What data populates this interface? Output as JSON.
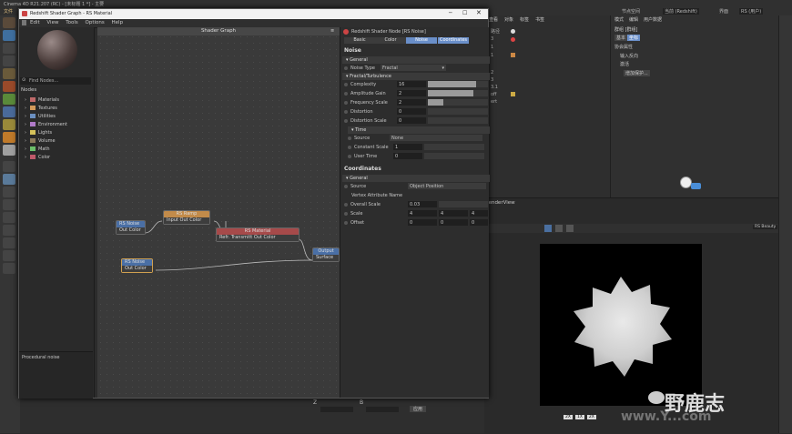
{
  "c4d": {
    "top_title": "Cinema 4D R21.207 (RC) - [未标题 1 *] - 主要",
    "top_menu_first": "文件",
    "top_right_label1": "节点空间",
    "top_right_label2": "当前 (Redshift)",
    "top_right_label3": "界面",
    "top_right_label4": "RS (用户)",
    "obj_menu": [
      "查看",
      "对象",
      "标签",
      "书签"
    ],
    "obj_rows": [
      "路径",
      "3",
      "1",
      "1",
      "2",
      "3",
      "3.1",
      "off",
      "ert"
    ],
    "attr_menu": [
      "模式",
      "编辑",
      "用户数据"
    ],
    "attr_obj_label": "群组 [群组]",
    "attr_tabs": [
      "基本",
      "坐标"
    ],
    "attr_section": "协会属性",
    "attr_row1": "输入反向",
    "attr_row2": "激活",
    "attr_button": "增加保护...",
    "rv_title": "RenderView",
    "rv_toolbar_label": "RS Beauty",
    "rv_bottom_labels": [
      "2X",
      "1X",
      "2X"
    ],
    "watermark_domain": "www.Y...com",
    "watermark_name": "野鹿志",
    "bottom_labels": [
      "Z",
      "B"
    ],
    "bottom_btn": "应用"
  },
  "window": {
    "title": "Redshift Shader Graph - RS Material",
    "menu": [
      "Edit",
      "View",
      "Tools",
      "Options",
      "Help"
    ],
    "controls": [
      "minimize",
      "maximize",
      "close"
    ]
  },
  "sidebar": {
    "search": "Find Nodes...",
    "nodes_label": "Nodes",
    "categories": [
      {
        "label": "Materials",
        "color": "#c06a6a"
      },
      {
        "label": "Textures",
        "color": "#d49a5a"
      },
      {
        "label": "Utilities",
        "color": "#6a8fc0"
      },
      {
        "label": "Environment",
        "color": "#b07ac9"
      },
      {
        "label": "Lights",
        "color": "#d6c25a"
      },
      {
        "label": "Volume",
        "color": "#8a7a5a"
      },
      {
        "label": "Math",
        "color": "#6cc06a"
      },
      {
        "label": "Color",
        "color": "#c05a6a"
      }
    ],
    "description": "Procedural noise"
  },
  "canvas": {
    "title": "Shader Graph",
    "nodes": {
      "noise1": {
        "title": "RS Noise",
        "port": "Out Color"
      },
      "ramp": {
        "title": "RS Ramp",
        "port": "Input  Out Color"
      },
      "material": {
        "title": "RS Material",
        "port": "Refr. Transmitt  Out Color"
      },
      "output": {
        "title": "Output",
        "port": "Surface"
      },
      "noise2": {
        "title": "RS Noise",
        "port": "Out Color"
      }
    }
  },
  "props": {
    "header": "Redshift Shader Node [RS Noise]",
    "tabs": [
      "Basic",
      "Color",
      "Noise",
      "Coordinates"
    ],
    "active_tab": "Noise",
    "noise_title": "Noise",
    "general": "General",
    "noise_type_label": "Noise Type",
    "noise_type_value": "Fractal",
    "fractal_section": "Fractal/Turbulence",
    "fractal": [
      {
        "label": "Complexity",
        "value": "16",
        "fill": 0.8
      },
      {
        "label": "Amplitude Gain",
        "value": "2",
        "fill": 0.75
      },
      {
        "label": "Frequency Scale",
        "value": "2",
        "fill": 0.25
      },
      {
        "label": "Distortion",
        "value": "0",
        "fill": 0
      },
      {
        "label": "Distortion Scale",
        "value": "0",
        "fill": 0
      }
    ],
    "time_section": "Time",
    "source_label": "Source",
    "source_value": "None",
    "constant_scale_label": "Constant Scale",
    "constant_scale_value": "1",
    "user_time_label": "User Time",
    "user_time_value": "0",
    "coords_title": "Coordinates",
    "coords_general": "General",
    "coords_source_label": "Source",
    "coords_source_value": "Object Position",
    "vertex_label": "Vertex Attribute Name",
    "overall_scale_label": "Overall Scale",
    "overall_scale_value": "0.03",
    "scale_label": "Scale",
    "scale_values": [
      "4",
      "4",
      "4"
    ],
    "offset_label": "Offset",
    "offset_values": [
      "0",
      "0",
      "0"
    ]
  }
}
